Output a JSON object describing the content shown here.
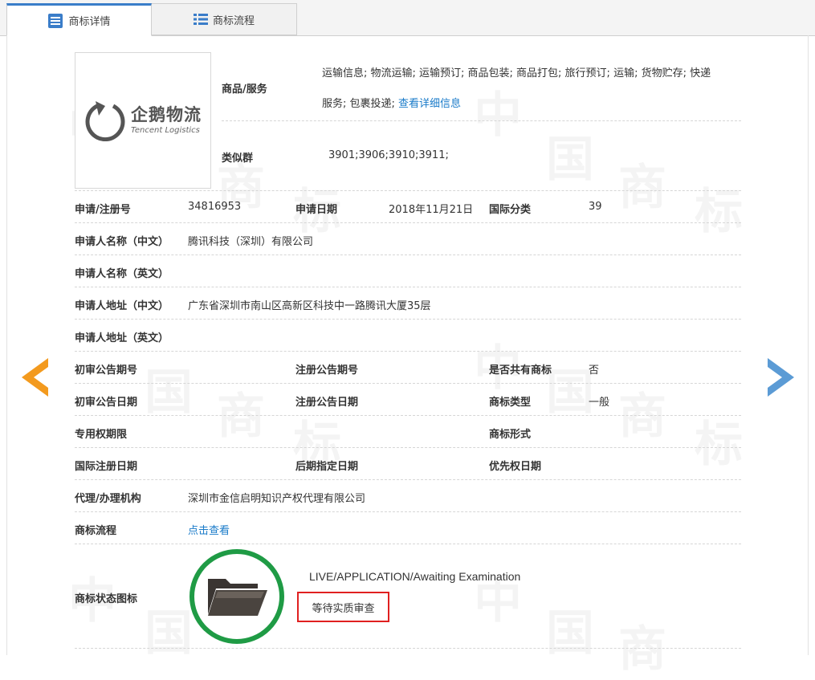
{
  "tabs": [
    {
      "label": "商标详情",
      "active": true
    },
    {
      "label": "商标流程",
      "active": false
    }
  ],
  "logo": {
    "cn": "企鹅物流",
    "en": "Tencent Logistics"
  },
  "goods": {
    "label": "商品/服务",
    "line1": "运输信息; 物流运输; 运输预订; 商品包装; 商品打包; 旅行预订; 运输; 货物贮存; 快递",
    "line2": "服务; 包裹投递;",
    "more_link": "查看详细信息"
  },
  "similar_group": {
    "label": "类似群",
    "value": "3901;3906;3910;3911;"
  },
  "fields": {
    "reg_no": {
      "label": "申请/注册号",
      "value": "34816953"
    },
    "apply_date": {
      "label": "申请日期",
      "value": "2018年11月21日"
    },
    "intl_class": {
      "label": "国际分类",
      "value": "39"
    },
    "applicant_cn": {
      "label": "申请人名称（中文）",
      "value": "腾讯科技（深圳）有限公司"
    },
    "applicant_en": {
      "label": "申请人名称（英文）",
      "value": ""
    },
    "address_cn": {
      "label": "申请人地址（中文）",
      "value": "广东省深圳市南山区高新区科技中一路腾讯大厦35层"
    },
    "address_en": {
      "label": "申请人地址（英文）",
      "value": ""
    },
    "prelim_pub_no": {
      "label": "初审公告期号",
      "value": ""
    },
    "reg_pub_no": {
      "label": "注册公告期号",
      "value": ""
    },
    "shared": {
      "label": "是否共有商标",
      "value": "否"
    },
    "prelim_pub_date": {
      "label": "初审公告日期",
      "value": ""
    },
    "reg_pub_date": {
      "label": "注册公告日期",
      "value": ""
    },
    "tm_type": {
      "label": "商标类型",
      "value": "一般"
    },
    "exclusive_period": {
      "label": "专用权期限",
      "value": ""
    },
    "tm_form": {
      "label": "商标形式",
      "value": ""
    },
    "intl_reg_date": {
      "label": "国际注册日期",
      "value": ""
    },
    "later_designation": {
      "label": "后期指定日期",
      "value": ""
    },
    "priority_date": {
      "label": "优先权日期",
      "value": ""
    },
    "agent": {
      "label": "代理/办理机构",
      "value": "深圳市金信启明知识产权代理有限公司"
    },
    "process": {
      "label": "商标流程",
      "link": "点击查看"
    }
  },
  "status": {
    "label": "商标状态图标",
    "en": "LIVE/APPLICATION/Awaiting Examination",
    "cn": "等待实质审查"
  },
  "colors": {
    "accent_blue": "#3a7dc9",
    "link_blue": "#1a7bc9",
    "prev_arrow": "#f39a1e",
    "next_arrow": "#5b9bd5",
    "status_ring": "#1f9b45",
    "status_box": "#e02020"
  },
  "icons": {
    "tab_detail": "list-detail-icon",
    "tab_flow": "list-flow-icon",
    "prev": "chevron-left-icon",
    "next": "chevron-right-icon",
    "status": "folder-open-icon"
  }
}
